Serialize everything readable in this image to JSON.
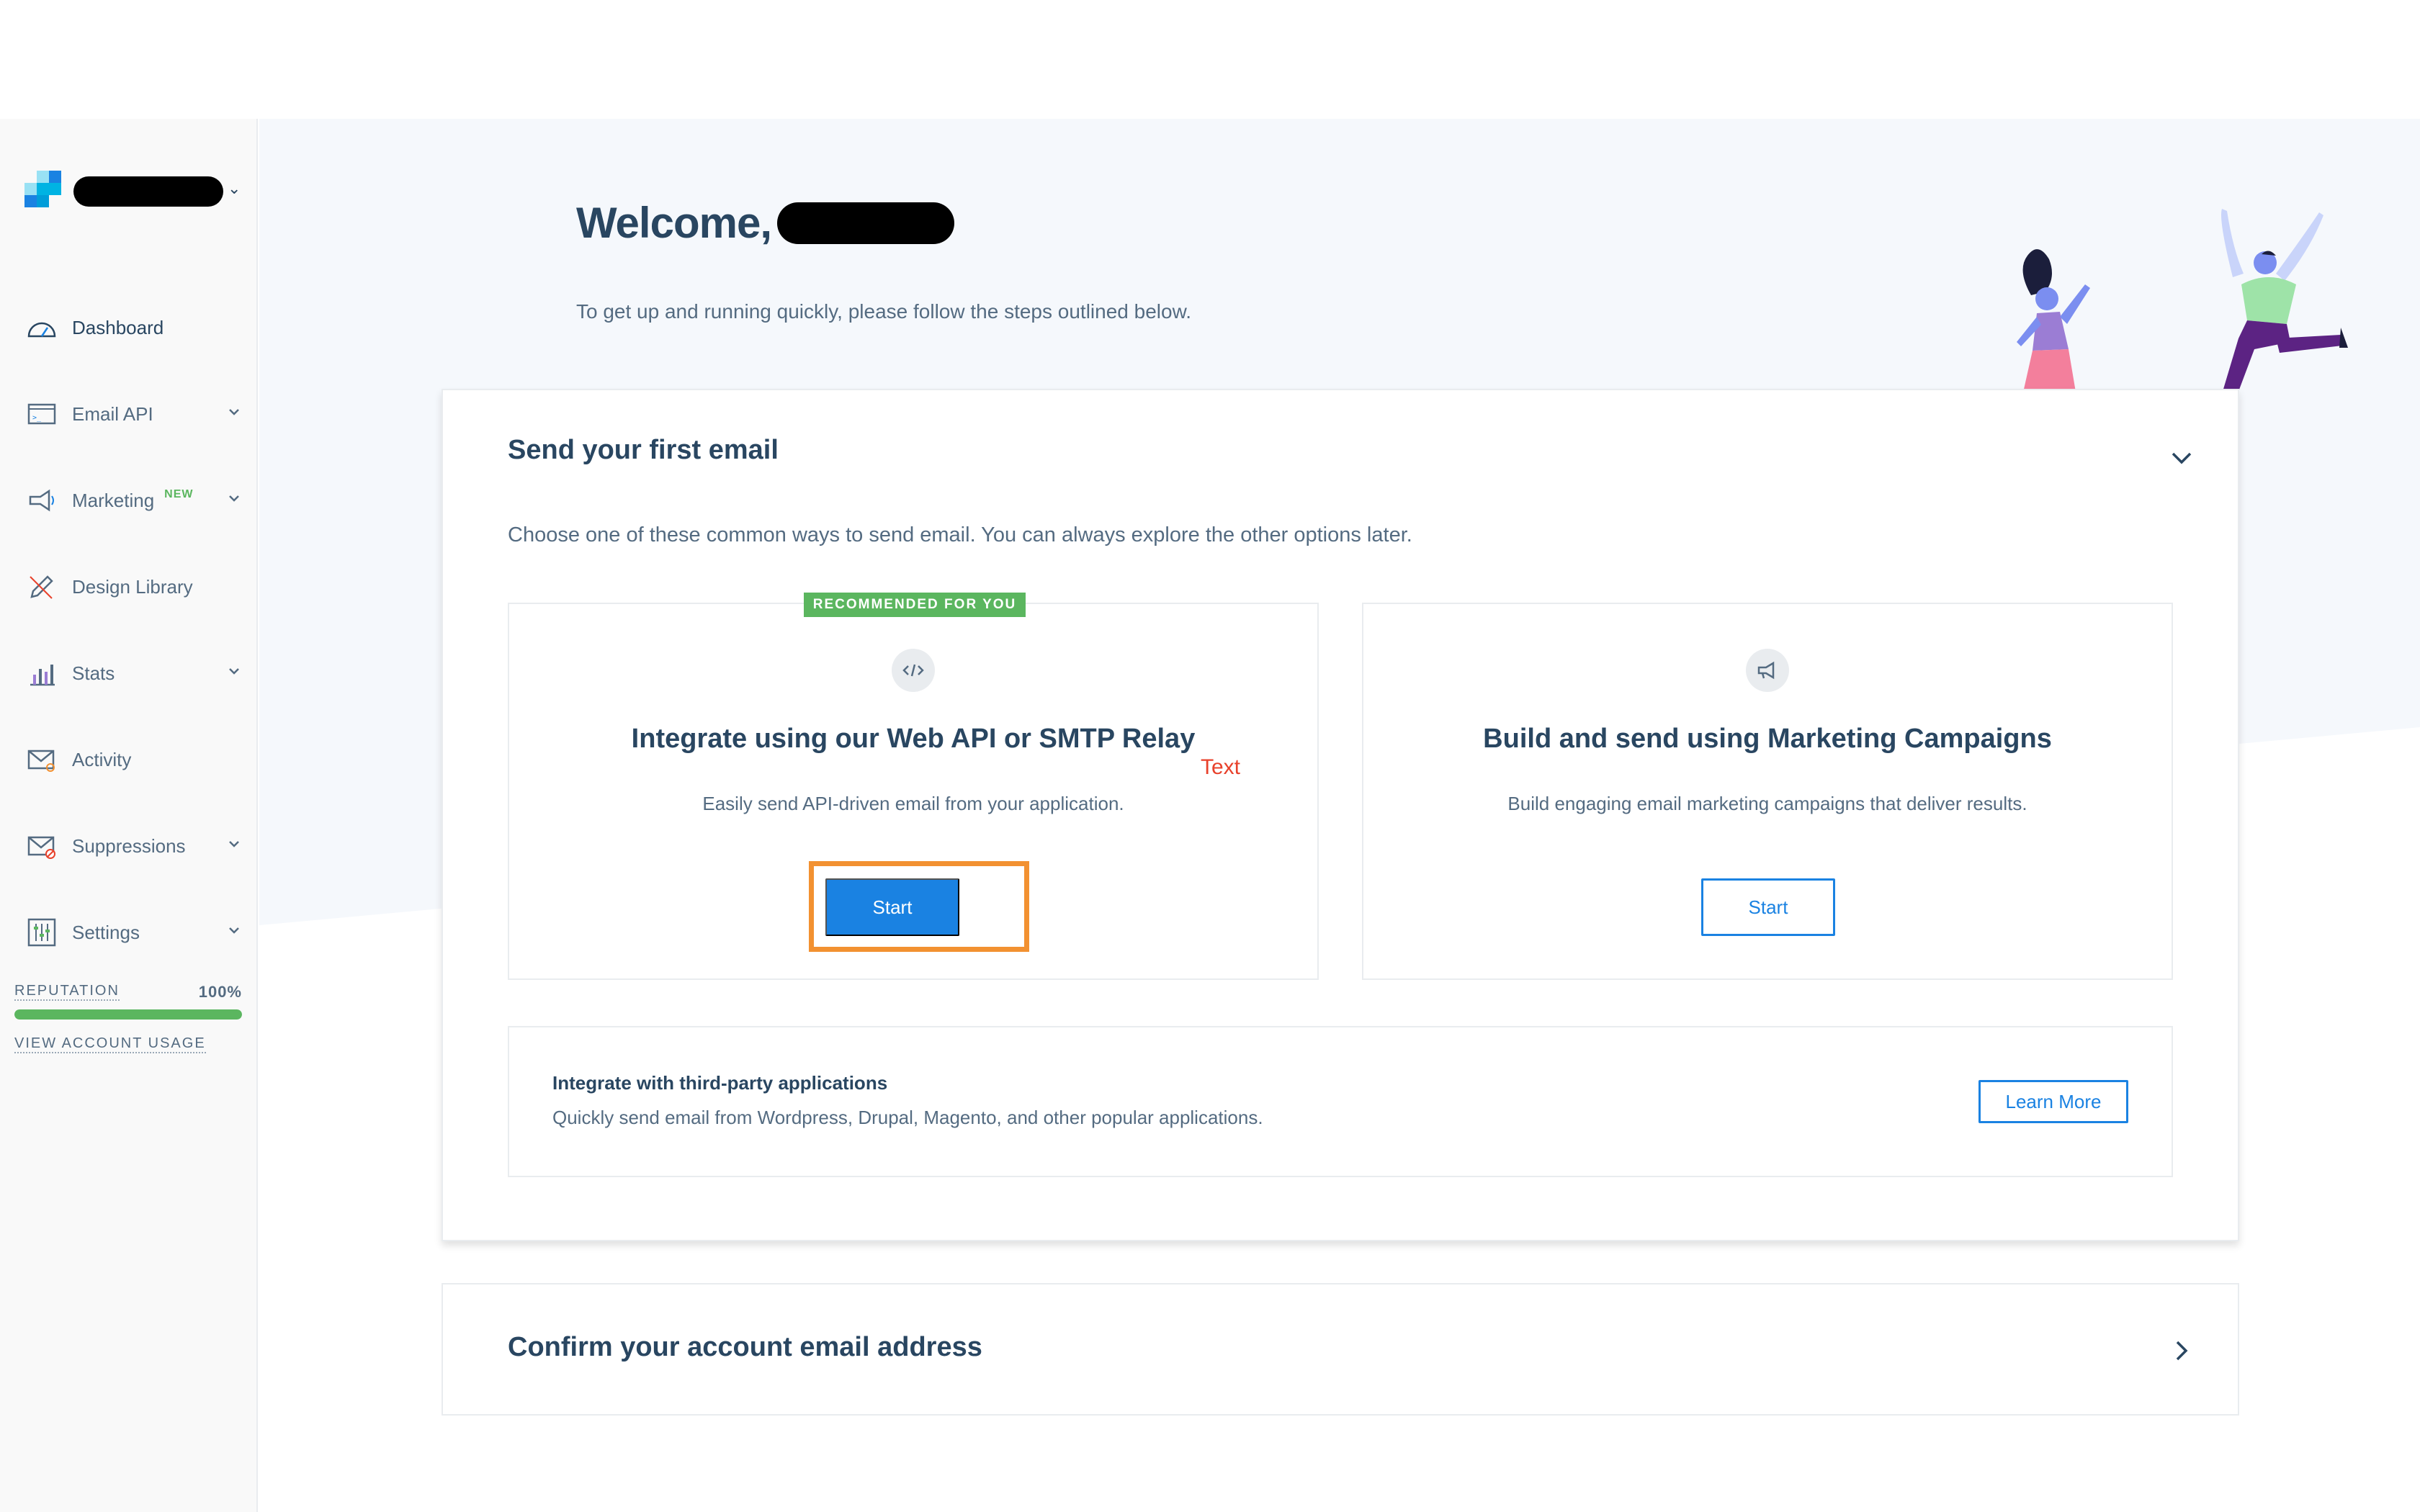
{
  "brand": {
    "logo_icon": "sendgrid-logo-icon",
    "account_name_redacted": ""
  },
  "nav": {
    "items": [
      {
        "label": "Dashboard",
        "icon": "dashboard-gauge-icon",
        "active": true
      },
      {
        "label": "Email API",
        "icon": "email-api-icon",
        "has_dropdown": true
      },
      {
        "label": "Marketing",
        "badge": "NEW",
        "icon": "megaphone-icon",
        "has_dropdown": true
      },
      {
        "label": "Design Library",
        "icon": "design-pencil-icon"
      },
      {
        "label": "Stats",
        "icon": "stats-chart-icon",
        "has_dropdown": true
      },
      {
        "label": "Activity",
        "icon": "activity-envelope-icon"
      },
      {
        "label": "Suppressions",
        "icon": "suppressions-envelope-icon",
        "has_dropdown": true
      },
      {
        "label": "Settings",
        "icon": "settings-sliders-icon",
        "has_dropdown": true
      }
    ]
  },
  "reputation": {
    "label": "REPUTATION",
    "value": "100%",
    "fraction": 1.0
  },
  "usage_link": "VIEW ACCOUNT USAGE",
  "welcome": {
    "greeting": "Welcome,",
    "subtitle": "To get up and running quickly, please follow the steps outlined below."
  },
  "send_card": {
    "title": "Send your first email",
    "description": "Choose one of these common ways to send email. You can always explore the other options later.",
    "options": [
      {
        "badge": "RECOMMENDED FOR YOU",
        "icon": "code-icon",
        "title": "Integrate using our Web API or SMTP Relay",
        "text": "Easily send API-driven email from your application.",
        "button": "Start",
        "annotation": "Text"
      },
      {
        "icon": "megaphone-icon",
        "title": "Build and send using Marketing Campaigns",
        "text": "Build engaging email marketing campaigns that deliver results.",
        "button": "Start"
      }
    ],
    "third_party": {
      "title": "Integrate with third-party applications",
      "text": "Quickly send email from Wordpress, Drupal, Magento, and other popular applications.",
      "button": "Learn More"
    }
  },
  "confirm_card": {
    "title": "Confirm your account email address"
  },
  "colors": {
    "primary": "#1a82e2",
    "text_dark": "#294661",
    "text_muted": "#546b81",
    "success": "#5bb65f",
    "highlight": "#f29131",
    "annotation": "#e8412b"
  }
}
